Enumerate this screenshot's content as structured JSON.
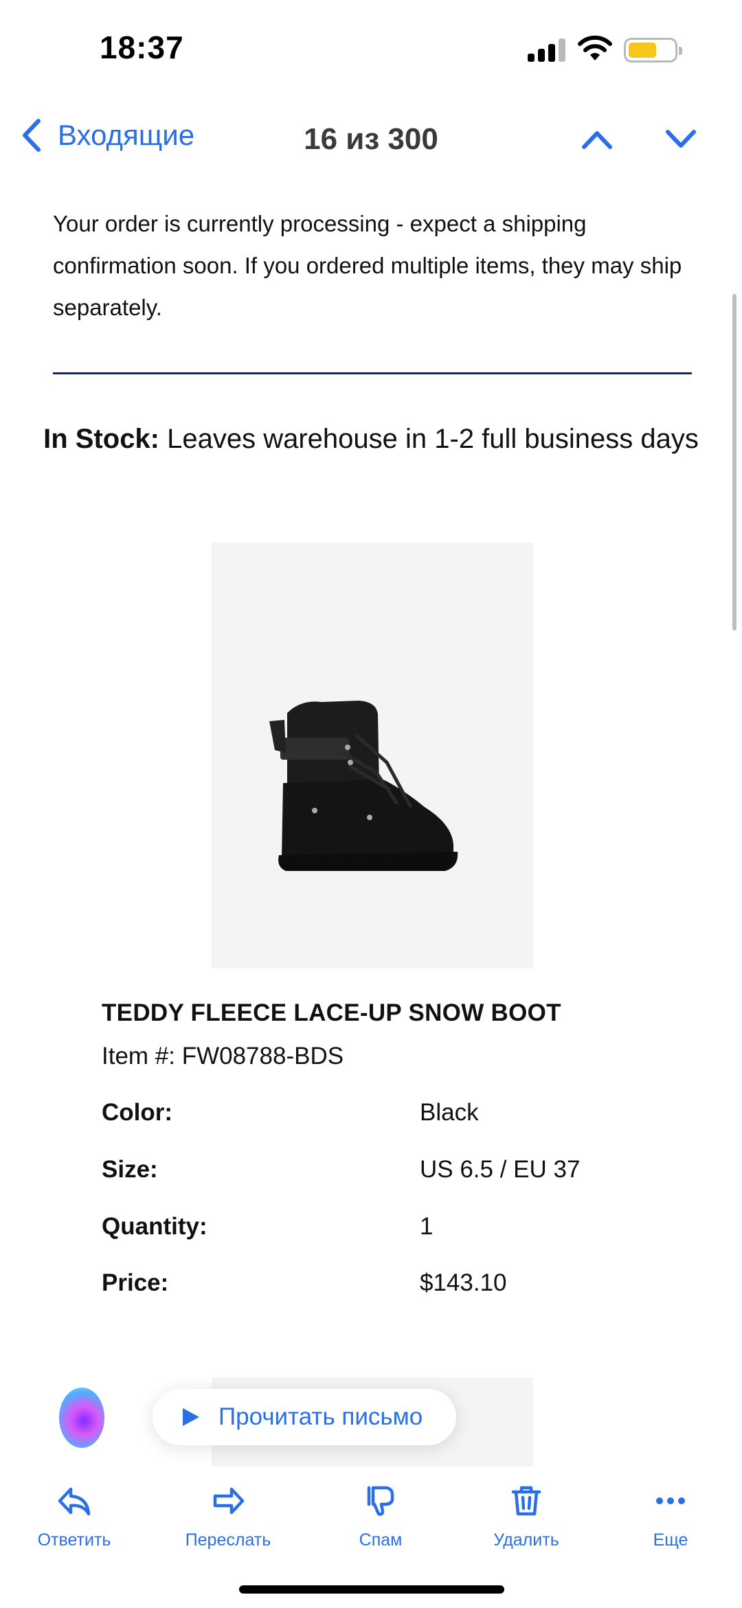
{
  "status": {
    "time": "18:37"
  },
  "nav": {
    "back_label": "Входящие",
    "counter": "16 из 300"
  },
  "email": {
    "intro": "Your order is currently processing - expect a shipping confirmation soon. If you ordered multiple items, they may ship separately.",
    "stock_label": "In Stock:",
    "stock_text": " Leaves warehouse in 1-2 full business days",
    "product": {
      "name": "TEDDY FLEECE LACE-UP SNOW BOOT",
      "item_number": "Item #: FW08788-BDS",
      "specs": [
        {
          "label": "Color:",
          "value": "Black"
        },
        {
          "label": "Size:",
          "value": "US 6.5 / EU 37"
        },
        {
          "label": "Quantity:",
          "value": "1"
        },
        {
          "label": "Price:",
          "value": "$143.10"
        }
      ]
    }
  },
  "read_button": {
    "label": "Прочитать письмо"
  },
  "toolbar": {
    "reply": "Ответить",
    "forward": "Переслать",
    "spam": "Спам",
    "delete": "Удалить",
    "more": "Еще"
  },
  "colors": {
    "accent": "#2a6fe6",
    "divider": "#1a2a5a",
    "battery": "#f6c619"
  }
}
